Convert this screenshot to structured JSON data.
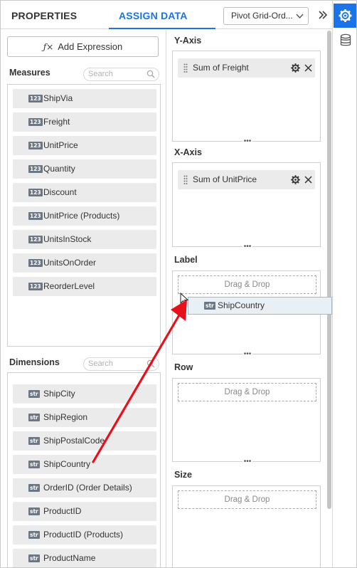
{
  "tabs": {
    "properties": "PROPERTIES",
    "assign_data": "ASSIGN DATA"
  },
  "widget_select": {
    "value": "Pivot Grid-Ord..."
  },
  "left_panel": {
    "add_expression": "Add Expression",
    "measures_title": "Measures",
    "measures_search_placeholder": "Search",
    "measures": [
      {
        "type": "123",
        "label": "ShipVia"
      },
      {
        "type": "123",
        "label": "Freight"
      },
      {
        "type": "123",
        "label": "UnitPrice"
      },
      {
        "type": "123",
        "label": "Quantity"
      },
      {
        "type": "123",
        "label": "Discount"
      },
      {
        "type": "123",
        "label": "UnitPrice (Products)"
      },
      {
        "type": "123",
        "label": "UnitsInStock"
      },
      {
        "type": "123",
        "label": "UnitsOnOrder"
      },
      {
        "type": "123",
        "label": "ReorderLevel"
      }
    ],
    "dimensions_title": "Dimensions",
    "dimensions_search_placeholder": "Search",
    "dimensions": [
      {
        "type": "str",
        "label": "ShipCity"
      },
      {
        "type": "str",
        "label": "ShipRegion"
      },
      {
        "type": "str",
        "label": "ShipPostalCode"
      },
      {
        "type": "str",
        "label": "ShipCountry"
      },
      {
        "type": "str",
        "label": "OrderID (Order Details)"
      },
      {
        "type": "str",
        "label": "ProductID"
      },
      {
        "type": "str",
        "label": "ProductID (Products)"
      },
      {
        "type": "str",
        "label": "ProductName"
      }
    ]
  },
  "right_panel": {
    "y_axis": {
      "title": "Y-Axis",
      "item": "Sum of Freight"
    },
    "x_axis": {
      "title": "X-Axis",
      "item": "Sum of UnitPrice"
    },
    "label": {
      "title": "Label",
      "placeholder": "Drag & Drop"
    },
    "row": {
      "title": "Row",
      "placeholder": "Drag & Drop"
    },
    "size": {
      "title": "Size",
      "placeholder": "Drag & Drop"
    }
  },
  "drag_ghost": {
    "type": "str",
    "label": "ShipCountry"
  },
  "icons": {
    "rail_active": "gear-icon",
    "rail_secondary": "database-icon",
    "collapse": "double-chevron-right-icon"
  },
  "colors": {
    "accent": "#1a73e8",
    "arrow": "#e8101a"
  }
}
